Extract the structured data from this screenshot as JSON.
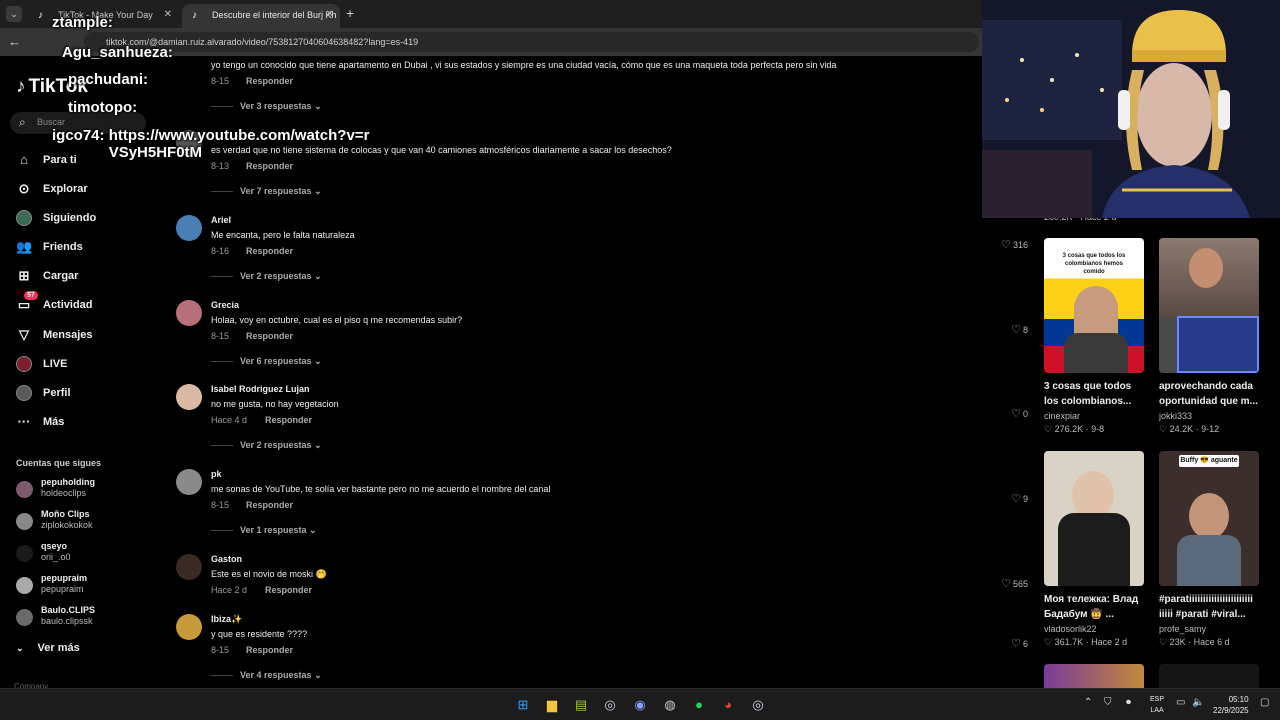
{
  "browser": {
    "tabs": [
      {
        "title": "TikTok - Make Your Day"
      },
      {
        "title": "Descubre el interior del Burj Kh"
      }
    ],
    "url": "tiktok.com/@damian.ruiz.alvarado/video/7538127040604638482?lang=es-419"
  },
  "sidebar": {
    "logo": "TikTok",
    "search_placeholder": "Buscar",
    "nav": [
      {
        "label": "Para ti",
        "icon": "home-icon"
      },
      {
        "label": "Explorar",
        "icon": "compass-icon"
      },
      {
        "label": "Siguiendo",
        "icon": "avatar"
      },
      {
        "label": "Friends",
        "icon": "friends-icon"
      },
      {
        "label": "Cargar",
        "icon": "upload-icon"
      },
      {
        "label": "Actividad",
        "icon": "inbox-icon",
        "badge": "57"
      },
      {
        "label": "Mensajes",
        "icon": "send-icon"
      },
      {
        "label": "LIVE",
        "icon": "live-icon"
      },
      {
        "label": "Perfil",
        "icon": "avatar"
      },
      {
        "label": "Más",
        "icon": "more-icon"
      }
    ],
    "following_title": "Cuentas que sigues",
    "accounts": [
      {
        "name": "pepuholding",
        "handle": "holdeoclips"
      },
      {
        "name": "Moño Clips",
        "handle": "ziplokokokok"
      },
      {
        "name": "qseyo",
        "handle": "orii_.o0"
      },
      {
        "name": "pepupraim",
        "handle": "pepupraim"
      },
      {
        "name": "Baulo.CLIPS",
        "handle": "baulo.clipssk"
      }
    ],
    "see_more": "Ver más",
    "company": "Company"
  },
  "comments": [
    {
      "user": "",
      "text": "yo tengo un conocido que tiene apartamento en Dubai , vi sus estados y siempre es una ciudad vacía, cómo que es una maqueta toda perfecta pero sin vida",
      "date": "8-15",
      "reply": "Responder",
      "replies": "Ver 3 respuestas",
      "likes": ""
    },
    {
      "user": "",
      "text": "es verdad que no tiene sistema de colocas y que van 40 camiones atmosféricos diariamente a sacar los desechos?",
      "date": "8-13",
      "reply": "Responder",
      "replies": "Ver 7 respuestas",
      "likes": ""
    },
    {
      "user": "Ariel",
      "text": "Me encanta, pero le falta naturaleza",
      "date": "8-16",
      "reply": "Responder",
      "replies": "Ver 2 respuestas",
      "likes": "316"
    },
    {
      "user": "Grecia",
      "text": "Holaa, voy en octubre, cual es el piso q me recomendas subir?",
      "date": "8-15",
      "reply": "Responder",
      "replies": "Ver 6 respuestas",
      "likes": "8"
    },
    {
      "user": "Isabel Rodriguez Lujan",
      "text": "no me gusta, no hay vegetacion",
      "date": "Hace 4 d",
      "reply": "Responder",
      "replies": "Ver 2 respuestas",
      "likes": "0"
    },
    {
      "user": "pk",
      "text": "me sonas de YouTube, te solía ver bastante pero no me acuerdo el nombre del canal",
      "date": "8-15",
      "reply": "Responder",
      "replies": "Ver 1 respuesta",
      "likes": "9"
    },
    {
      "user": "Gaston",
      "text": "Este es el novio de moski 🤭",
      "date": "Hace 2 d",
      "reply": "Responder",
      "replies": "",
      "likes": "565"
    },
    {
      "user": "Ibiza✨",
      "text": "y que es residente ????",
      "date": "8-15",
      "reply": "Responder",
      "replies": "Ver 4 respuestas",
      "likes": "6"
    }
  ],
  "videos": [
    {
      "overlay": "3 cosas que todos los colombianos hemos comido",
      "title": "3 cosas que todos los colombianos...",
      "author": "cinexpiar",
      "likes": "276.2K",
      "date": "9-8"
    },
    {
      "overlay": "",
      "title": "aprovechando cada oportunidad que m...",
      "author": "jokki333",
      "likes": "24.2K",
      "date": "9-12"
    },
    {
      "overlay": "",
      "title": "Моя тележка: Влад Бадабум 🤠 ...",
      "author": "vladosorlik22",
      "likes": "361.7K",
      "date": "Hace 2 d"
    },
    {
      "overlay": "Buffy 😎 aguante",
      "title": "#paratiiiiiiiiiiiiiiiiiiiiiii iiiii #parati #viral...",
      "author": "profe_samy",
      "likes": "23K",
      "date": "Hace 6 d"
    }
  ],
  "partial_stats": "280.2K · Hace 2 d",
  "chat": [
    {
      "user": "ztample:",
      "msg": ""
    },
    {
      "user": "Agu_sanhueza:",
      "msg": ""
    },
    {
      "user": "pachudani:",
      "msg": ""
    },
    {
      "user": "timotopo:",
      "msg": ""
    },
    {
      "user": "igco74:",
      "msg": "https://www.youtube.com/watch?v=rVSyH5HF0tM"
    }
  ],
  "taskbar": {
    "lang": "ESP",
    "lang2": "LAA",
    "time": "05:10",
    "date": "22/9/2025"
  }
}
